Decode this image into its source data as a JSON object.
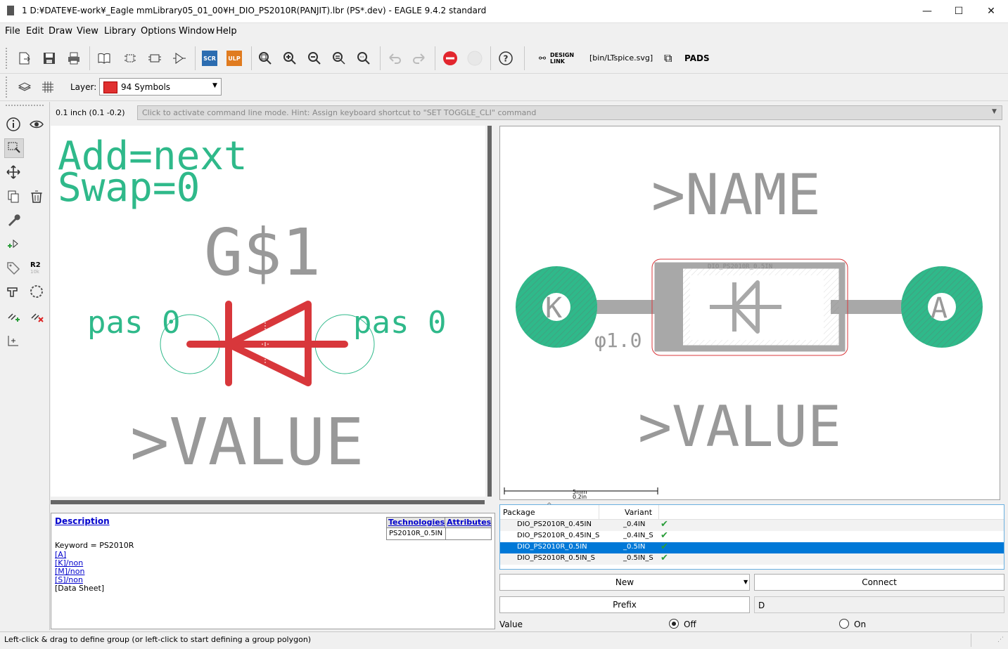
{
  "window": {
    "title": "1 D:¥DATE¥E-work¥_Eagle mmLibrary05_01_00¥H_DIO_PS2010R(PANJIT).lbr (PS*.dev) - EAGLE 9.4.2 standard",
    "minimize": "—",
    "maximize": "☐",
    "close": "✕"
  },
  "menu": [
    "File",
    "Edit",
    "Draw",
    "View",
    "Library",
    "Options",
    "Window",
    "Help"
  ],
  "toolbar": {
    "scr": "SCR",
    "ulp": "ULP",
    "design_link": "DESIGN\nLINK",
    "design_link_1": "DESIGN",
    "design_link_2": "LINK",
    "script_value": "[bin/LTspice.svg]",
    "pads": "PADS"
  },
  "layer": {
    "label": "Layer:",
    "value": "94 Symbols",
    "color": "#e03030"
  },
  "coords": "0.1 inch (0.1 -0.2)",
  "command_line": {
    "placeholder": "Click to activate command line mode. Hint: Assign keyboard shortcut to \"SET TOGGLE_CLI\" command"
  },
  "left_tools": {
    "r2": "R2",
    "r2_sub": "10k"
  },
  "symbol": {
    "add_text": "Add=next",
    "swap_text": "Swap=0",
    "gate_name": "G$1",
    "pin_left": "pas 0",
    "pin_right": "pas 0",
    "value": ">VALUE",
    "diode_color": "#d8373b",
    "text_color": "#2fb98a"
  },
  "package": {
    "name": ">NAME",
    "value": ">VALUE",
    "pad_left": "K",
    "pad_right": "A",
    "drill_label": "φ1.0",
    "package_label": "DIO_PS2010R_0.5IN",
    "scale_mm": "5mm",
    "scale_in": "0.2in",
    "pad_color": "#2fb98a"
  },
  "description": {
    "heading": "Description",
    "keyword": "Keyword = PS2010R",
    "links": [
      "[A]",
      "[K]/non",
      "[M]/non",
      "[S]/non"
    ],
    "datasheet": "[Data Sheet]",
    "tech_header": "Technologies",
    "attr_header": "Attributes",
    "tech_value": "PS2010R_0.5IN"
  },
  "variants": {
    "col_package": "Package",
    "col_variant": "Variant",
    "rows": [
      {
        "package": "DIO_PS2010R_0.45IN",
        "variant": "_0.4IN",
        "selected": false
      },
      {
        "package": "DIO_PS2010R_0.45IN_S",
        "variant": "_0.4IN_S",
        "selected": false
      },
      {
        "package": "DIO_PS2010R_0.5IN",
        "variant": "_0.5IN",
        "selected": true
      },
      {
        "package": "DIO_PS2010R_0.5IN_S",
        "variant": "_0.5IN_S",
        "selected": false
      }
    ]
  },
  "buttons": {
    "new": "New",
    "connect": "Connect",
    "prefix": "Prefix",
    "prefix_value": "D"
  },
  "value_option": {
    "label": "Value",
    "off": "Off",
    "on": "On",
    "selected": "Off"
  },
  "status": "Left-click & drag to define group (or left-click to start defining a group polygon)"
}
